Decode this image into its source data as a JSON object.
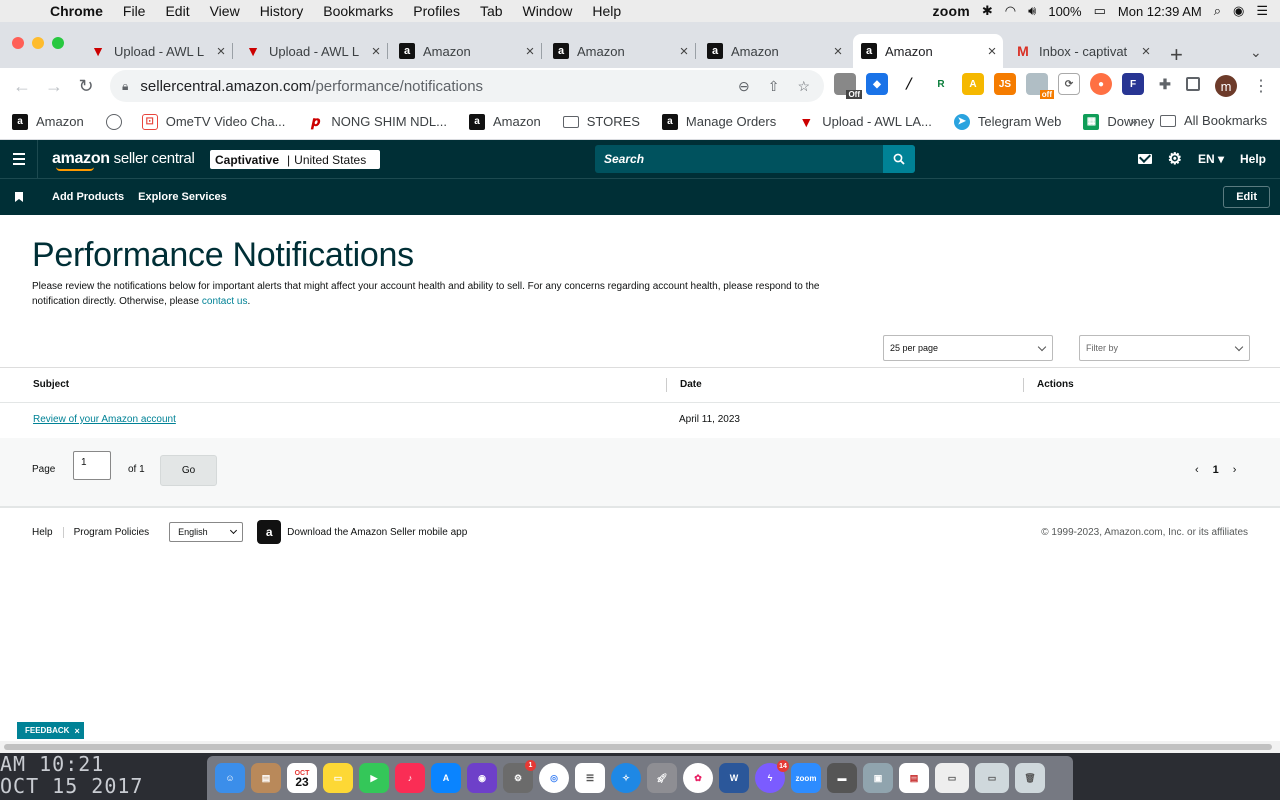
{
  "menubar": {
    "app": "Chrome",
    "items": [
      "File",
      "Edit",
      "View",
      "History",
      "Bookmarks",
      "Profiles",
      "Tab",
      "Window",
      "Help"
    ],
    "zoom": "zoom",
    "battery": "100%",
    "clock": "Mon 12:39 AM"
  },
  "tabs": [
    {
      "title": "Upload - AWL L",
      "icon": "awl-icon"
    },
    {
      "title": "Upload - AWL L",
      "icon": "awl-icon"
    },
    {
      "title": "Amazon",
      "icon": "amazon-icon"
    },
    {
      "title": "Amazon",
      "icon": "amazon-icon"
    },
    {
      "title": "Amazon",
      "icon": "amazon-icon"
    },
    {
      "title": "Amazon",
      "icon": "amazon-icon"
    },
    {
      "title": "Inbox - captivat",
      "icon": "gmail-icon"
    }
  ],
  "address": {
    "host": "sellercentral.amazon.com",
    "path": "/performance/notifications"
  },
  "extensions": {
    "off1": "Off",
    "off2": "off",
    "profile_initial": "m"
  },
  "bookmarks": [
    {
      "label": "Amazon",
      "icon": "amazon-icon"
    },
    {
      "label": "",
      "icon": "globe-icon"
    },
    {
      "label": "OmeTV Video Cha...",
      "icon": "ometv-icon"
    },
    {
      "label": "NONG SHIM NDL...",
      "icon": "pinterest-icon"
    },
    {
      "label": "Amazon",
      "icon": "amazon-icon"
    },
    {
      "label": "STORES",
      "icon": "folder-icon"
    },
    {
      "label": "Manage Orders",
      "icon": "amazon-icon"
    },
    {
      "label": "Upload - AWL LA...",
      "icon": "awl-icon"
    },
    {
      "label": "Telegram Web",
      "icon": "telegram-icon"
    },
    {
      "label": "Downey",
      "icon": "sheets-icon"
    }
  ],
  "bookmarks_all": "All Bookmarks",
  "header": {
    "logo_bold": "amazon",
    "logo_rest": " seller central",
    "account_name": "Captivative",
    "account_region": "United States",
    "search_placeholder": "Search",
    "language": "EN",
    "help": "Help"
  },
  "subnav": {
    "links": [
      "Add Products",
      "Explore Services"
    ],
    "edit": "Edit"
  },
  "page": {
    "title": "Performance Notifications",
    "intro_1": "Please review the notifications below for important alerts that might affect your account health and ability to sell. For any concerns regarding account health, please respond to the notification directly. Otherwise, please ",
    "intro_link": "contact us",
    "intro_2": ".",
    "per_page": "25 per page",
    "filter": "Filter by"
  },
  "table": {
    "headers": [
      "Subject",
      "Date",
      "Actions"
    ],
    "rows": [
      {
        "subject": "Review of your Amazon account",
        "date": "April 11, 2023",
        "actions": ""
      }
    ]
  },
  "pager": {
    "label": "Page",
    "value": "1",
    "of": "of 1",
    "go": "Go",
    "current": "1"
  },
  "footer": {
    "help": "Help",
    "policies": "Program Policies",
    "language": "English",
    "app": "Download the Amazon Seller mobile app",
    "copyright": "© 1999-2023, Amazon.com, Inc. or its affiliates"
  },
  "feedback": "FEEDBACK",
  "desktop_clock": {
    "line1": "AM 10:21",
    "line2": "OCT 15 2017"
  },
  "dock": {
    "calendar_month": "OCT",
    "calendar_day": "23",
    "badge_1": "1",
    "badge_2": "14",
    "zoom": "zoom"
  }
}
